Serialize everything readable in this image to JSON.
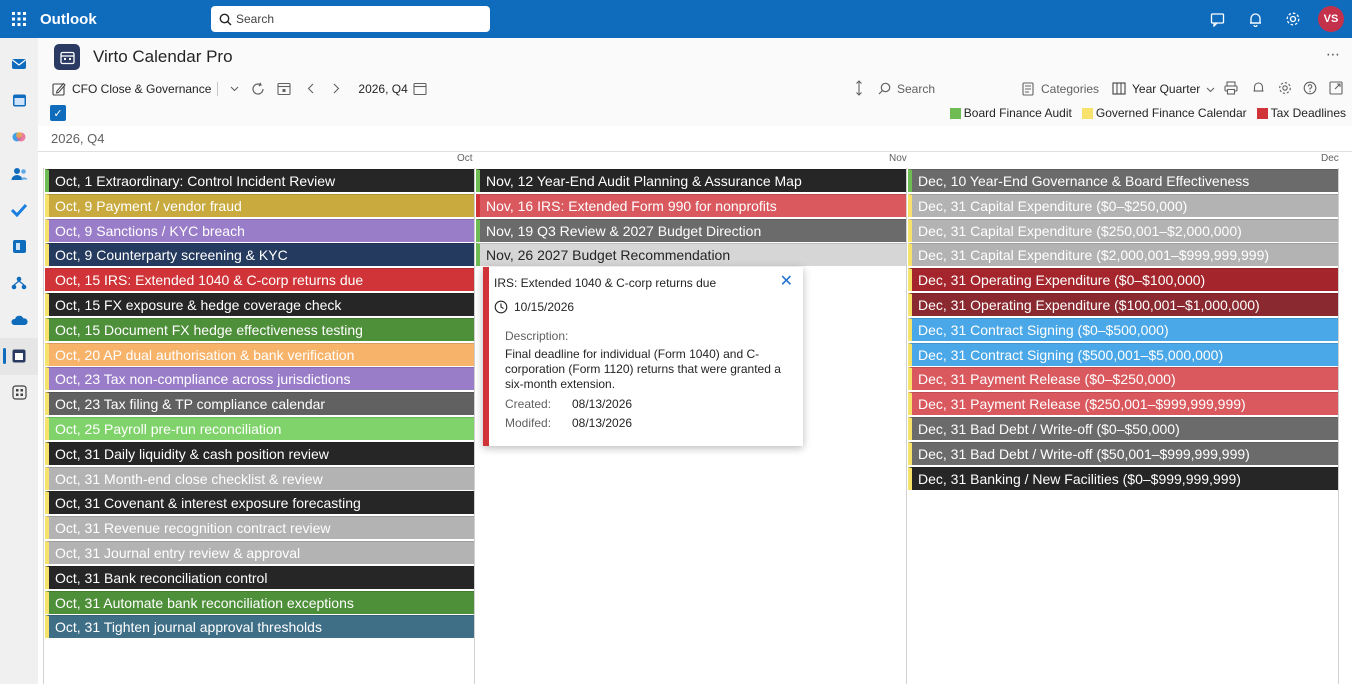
{
  "topbar": {
    "brand": "Outlook",
    "search_placeholder": "Search",
    "avatar": "VS"
  },
  "app": {
    "title": "Virto Calendar Pro"
  },
  "toolbar": {
    "calendar_name": "CFO Close & Governance",
    "period": "2026, Q4",
    "search": "Search",
    "categories": "Categories",
    "view": "Year Quarter"
  },
  "legend": [
    {
      "label": "Board Finance Audit",
      "color": "#6fbb54"
    },
    {
      "label": "Governed Finance Calendar",
      "color": "#f7e26b"
    },
    {
      "label": "Tax Deadlines",
      "color": "#d13438"
    }
  ],
  "period_label": "2026, Q4",
  "months": [
    "Oct",
    "Nov",
    "Dec"
  ],
  "columns": [
    {
      "events": [
        {
          "date": "Oct, 1",
          "title": "Extraordinary: Control Incident Review",
          "bg": "#262626",
          "bar": "#6fbb54",
          "fg": "#ffffff"
        },
        {
          "date": "Oct, 9",
          "title": "Payment / vendor fraud",
          "bg": "#c9aa3f",
          "bar": "#f7e26b",
          "fg": "#ffffff"
        },
        {
          "date": "Oct, 9",
          "title": "Sanctions / KYC breach",
          "bg": "#9a7dc8",
          "bar": "#f7e26b",
          "fg": "#ffffff"
        },
        {
          "date": "Oct, 9",
          "title": "Counterparty screening & KYC",
          "bg": "#243a5e",
          "bar": "#f7e26b",
          "fg": "#ffffff"
        },
        {
          "date": "Oct, 15",
          "title": "IRS: Extended 1040 & C-corp returns due",
          "bg": "#d13438",
          "bar": "#d13438",
          "fg": "#ffffff"
        },
        {
          "date": "Oct, 15",
          "title": "FX exposure & hedge coverage check",
          "bg": "#262626",
          "bar": "#f7e26b",
          "fg": "#ffffff"
        },
        {
          "date": "Oct, 15",
          "title": "Document FX hedge effectiveness testing",
          "bg": "#4e8f3a",
          "bar": "#f7e26b",
          "fg": "#ffffff"
        },
        {
          "date": "Oct, 20",
          "title": "AP dual authorisation & bank verification",
          "bg": "#f7b36a",
          "bar": "#f7e26b",
          "fg": "#ffffff"
        },
        {
          "date": "Oct, 23",
          "title": "Tax non-compliance across jurisdictions",
          "bg": "#9a7dc8",
          "bar": "#f7e26b",
          "fg": "#ffffff"
        },
        {
          "date": "Oct, 23",
          "title": "Tax filing & TP compliance calendar",
          "bg": "#616161",
          "bar": "#f7e26b",
          "fg": "#ffffff"
        },
        {
          "date": "Oct, 25",
          "title": "Payroll pre-run reconciliation",
          "bg": "#7fd36a",
          "bar": "#f7e26b",
          "fg": "#ffffff"
        },
        {
          "date": "Oct, 31",
          "title": "Daily liquidity & cash position review",
          "bg": "#262626",
          "bar": "#f7e26b",
          "fg": "#ffffff"
        },
        {
          "date": "Oct, 31",
          "title": "Month-end close checklist & review",
          "bg": "#b3b3b3",
          "bar": "#f7e26b",
          "fg": "#ffffff"
        },
        {
          "date": "Oct, 31",
          "title": "Covenant & interest exposure forecasting",
          "bg": "#262626",
          "bar": "#f7e26b",
          "fg": "#ffffff"
        },
        {
          "date": "Oct, 31",
          "title": "Revenue recognition contract review",
          "bg": "#b3b3b3",
          "bar": "#f7e26b",
          "fg": "#ffffff"
        },
        {
          "date": "Oct, 31",
          "title": "Journal entry review & approval",
          "bg": "#b3b3b3",
          "bar": "#f7e26b",
          "fg": "#ffffff"
        },
        {
          "date": "Oct, 31",
          "title": "Bank reconciliation control",
          "bg": "#262626",
          "bar": "#f7e26b",
          "fg": "#ffffff"
        },
        {
          "date": "Oct, 31",
          "title": "Automate bank reconciliation exceptions",
          "bg": "#4e8f3a",
          "bar": "#f7e26b",
          "fg": "#ffffff"
        },
        {
          "date": "Oct, 31",
          "title": "Tighten journal approval thresholds",
          "bg": "#3f6e87",
          "bar": "#f7e26b",
          "fg": "#ffffff"
        }
      ]
    },
    {
      "events": [
        {
          "date": "Nov, 12",
          "title": "Year-End Audit Planning & Assurance Map",
          "bg": "#262626",
          "bar": "#6fbb54",
          "fg": "#ffffff"
        },
        {
          "date": "Nov, 16",
          "title": "IRS: Extended Form 990 for nonprofits",
          "bg": "#d9595e",
          "bar": "#d13438",
          "fg": "#ffffff"
        },
        {
          "date": "Nov, 19",
          "title": "Q3 Review & 2027 Budget Direction",
          "bg": "#6b6b6b",
          "bar": "#6fbb54",
          "fg": "#ffffff"
        },
        {
          "date": "Nov, 26",
          "title": "2027 Budget Recommendation",
          "bg": "#d6d6d6",
          "bar": "#6fbb54",
          "fg": "#242424"
        }
      ]
    },
    {
      "events": [
        {
          "date": "Dec, 10",
          "title": "Year-End Governance & Board Effectiveness",
          "bg": "#6b6b6b",
          "bar": "#6fbb54",
          "fg": "#ffffff"
        },
        {
          "date": "Dec, 31",
          "title": "Capital Expenditure ($0–$250,000)",
          "bg": "#b3b3b3",
          "bar": "#f7e26b",
          "fg": "#ffffff"
        },
        {
          "date": "Dec, 31",
          "title": "Capital Expenditure ($250,001–$2,000,000)",
          "bg": "#b3b3b3",
          "bar": "#f7e26b",
          "fg": "#ffffff"
        },
        {
          "date": "Dec, 31",
          "title": "Capital Expenditure ($2,000,001–$999,999,999)",
          "bg": "#b3b3b3",
          "bar": "#f7e26b",
          "fg": "#ffffff"
        },
        {
          "date": "Dec, 31",
          "title": "Operating Expenditure ($0–$100,000)",
          "bg": "#a4262c",
          "bar": "#f7e26b",
          "fg": "#ffffff"
        },
        {
          "date": "Dec, 31",
          "title": "Operating Expenditure ($100,001–$1,000,000)",
          "bg": "#8a2a30",
          "bar": "#f7e26b",
          "fg": "#ffffff"
        },
        {
          "date": "Dec, 31",
          "title": "Contract Signing ($0–$500,000)",
          "bg": "#4aa8e8",
          "bar": "#f7e26b",
          "fg": "#ffffff"
        },
        {
          "date": "Dec, 31",
          "title": "Contract Signing ($500,001–$5,000,000)",
          "bg": "#4aa8e8",
          "bar": "#f7e26b",
          "fg": "#ffffff"
        },
        {
          "date": "Dec, 31",
          "title": "Payment Release ($0–$250,000)",
          "bg": "#d9595e",
          "bar": "#f7e26b",
          "fg": "#ffffff"
        },
        {
          "date": "Dec, 31",
          "title": "Payment Release ($250,001–$999,999,999)",
          "bg": "#d9595e",
          "bar": "#f7e26b",
          "fg": "#ffffff"
        },
        {
          "date": "Dec, 31",
          "title": "Bad Debt / Write-off ($0–$50,000)",
          "bg": "#6b6b6b",
          "bar": "#f7e26b",
          "fg": "#ffffff"
        },
        {
          "date": "Dec, 31",
          "title": "Bad Debt / Write-off ($50,001–$999,999,999)",
          "bg": "#6b6b6b",
          "bar": "#f7e26b",
          "fg": "#ffffff"
        },
        {
          "date": "Dec, 31",
          "title": "Banking / New Facilities ($0–$999,999,999)",
          "bg": "#262626",
          "bar": "#f7e26b",
          "fg": "#ffffff"
        }
      ]
    }
  ],
  "popup": {
    "title": "IRS: Extended 1040 & C-corp returns due",
    "date": "10/15/2026",
    "description_label": "Description:",
    "description": "Final deadline for individual (Form 1040) and C-corporation (Form 1120) returns that were granted a six-month extension.",
    "created_label": "Created:",
    "created": "08/13/2026",
    "modified_label": "Modifed:",
    "modified": "08/13/2026"
  }
}
